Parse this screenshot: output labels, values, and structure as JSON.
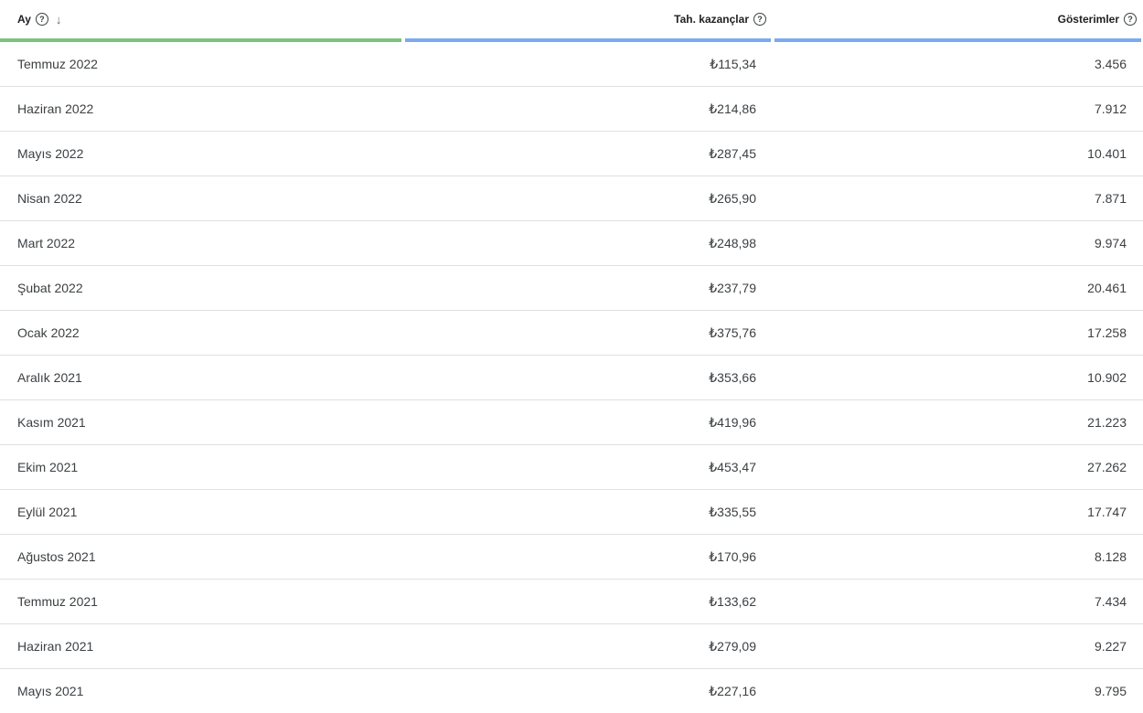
{
  "header": {
    "month_label": "Ay",
    "earnings_label": "Tah. kazançlar",
    "impressions_label": "Gösterimler",
    "help_glyph": "?",
    "sort_glyph": "↓"
  },
  "rows": [
    {
      "month": "Temmuz 2022",
      "earnings": "₺115,34",
      "impressions": "3.456"
    },
    {
      "month": "Haziran 2022",
      "earnings": "₺214,86",
      "impressions": "7.912"
    },
    {
      "month": "Mayıs 2022",
      "earnings": "₺287,45",
      "impressions": "10.401"
    },
    {
      "month": "Nisan 2022",
      "earnings": "₺265,90",
      "impressions": "7.871"
    },
    {
      "month": "Mart 2022",
      "earnings": "₺248,98",
      "impressions": "9.974"
    },
    {
      "month": "Şubat 2022",
      "earnings": "₺237,79",
      "impressions": "20.461"
    },
    {
      "month": "Ocak 2022",
      "earnings": "₺375,76",
      "impressions": "17.258"
    },
    {
      "month": "Aralık 2021",
      "earnings": "₺353,66",
      "impressions": "10.902"
    },
    {
      "month": "Kasım 2021",
      "earnings": "₺419,96",
      "impressions": "21.223"
    },
    {
      "month": "Ekim 2021",
      "earnings": "₺453,47",
      "impressions": "27.262"
    },
    {
      "month": "Eylül 2021",
      "earnings": "₺335,55",
      "impressions": "17.747"
    },
    {
      "month": "Ağustos 2021",
      "earnings": "₺170,96",
      "impressions": "8.128"
    },
    {
      "month": "Temmuz 2021",
      "earnings": "₺133,62",
      "impressions": "7.434"
    },
    {
      "month": "Haziran 2021",
      "earnings": "₺279,09",
      "impressions": "9.227"
    },
    {
      "month": "Mayıs 2021",
      "earnings": "₺227,16",
      "impressions": "9.795"
    }
  ],
  "colors": {
    "month_bar": "#7cc27c",
    "metric_bar": "#7baaf0"
  }
}
